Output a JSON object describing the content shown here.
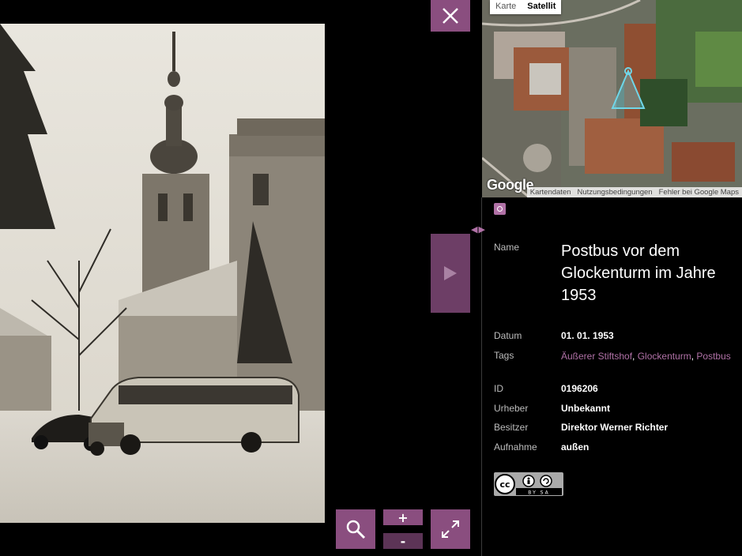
{
  "close_icon": "close-icon",
  "map": {
    "types": [
      "Karte",
      "Satellit"
    ],
    "active_type": "Satellit",
    "logo": "Google",
    "footer": [
      "Kartendaten",
      "Nutzungsbedingungen",
      "Fehler bei Google Maps"
    ]
  },
  "details": {
    "name_label": "Name",
    "title": "Postbus vor dem Glockenturm im Jahre 1953",
    "date_label": "Datum",
    "date": "01. 01. 1953",
    "tags_label": "Tags",
    "tags": [
      "Äußerer Stiftshof",
      "Glockenturm",
      "Postbus"
    ],
    "id_label": "ID",
    "id": "0196206",
    "author_label": "Urheber",
    "author": "Unbekannt",
    "owner_label": "Besitzer",
    "owner": "Direktor Werner Richter",
    "shot_label": "Aufnahme",
    "shot": "außen"
  },
  "license": {
    "text": "BY SA"
  },
  "controls": {
    "plus": "+",
    "minus": "-"
  },
  "colors": {
    "accent": "#8a4e7f",
    "link": "#b071a6"
  }
}
